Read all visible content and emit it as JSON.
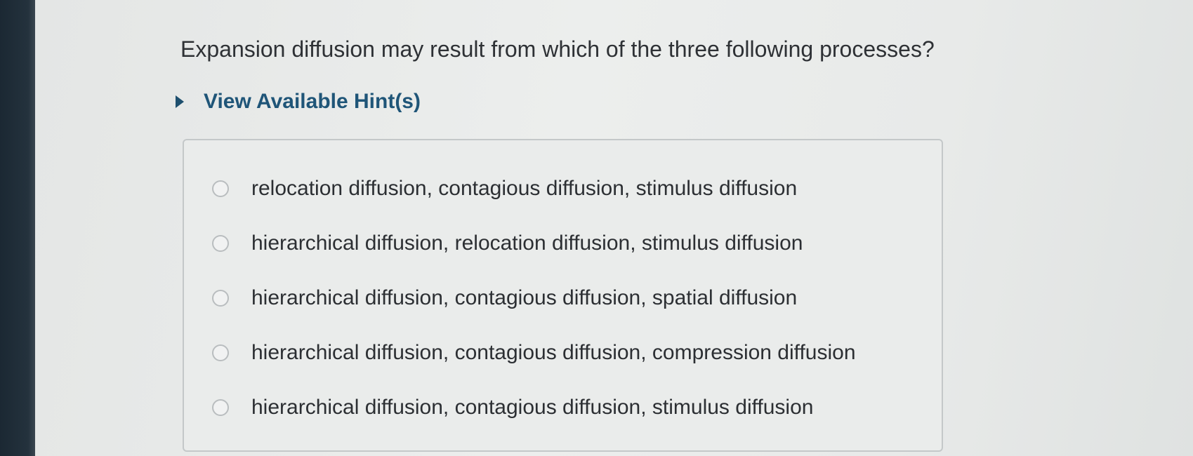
{
  "question": {
    "text": "Expansion diffusion may result from which of the three following processes?"
  },
  "hint": {
    "label": "View Available Hint(s)",
    "icon": "triangle-right-icon"
  },
  "options": [
    {
      "label": "relocation diffusion, contagious diffusion, stimulus diffusion",
      "selected": false
    },
    {
      "label": "hierarchical diffusion, relocation diffusion, stimulus diffusion",
      "selected": false
    },
    {
      "label": "hierarchical diffusion, contagious diffusion, spatial diffusion",
      "selected": false
    },
    {
      "label": "hierarchical diffusion, contagious diffusion, compression diffusion",
      "selected": false
    },
    {
      "label": "hierarchical diffusion, contagious diffusion, stimulus diffusion",
      "selected": false
    }
  ],
  "colors": {
    "hint_text": "#1f5578",
    "question_text": "#2e3135",
    "radio_border": "#b9bdbf"
  }
}
